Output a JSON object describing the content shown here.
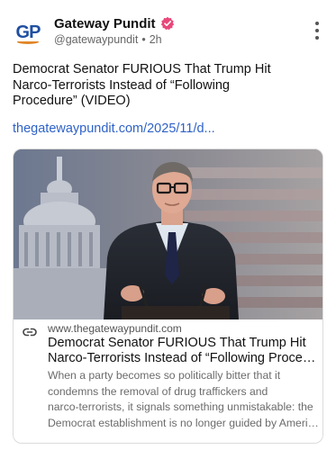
{
  "account": {
    "name": "Gateway Pundit",
    "handle": "@gatewaypundit",
    "separator": "•",
    "time": "2h",
    "avatar_text": "GP",
    "verified_icon": "verified-badge-icon",
    "brand_colors": {
      "blue": "#1f4fa0",
      "orange": "#e0872a",
      "verified": "#e8487a"
    }
  },
  "menu_icon": "more-vertical-icon",
  "post": {
    "text_lines": [
      "Democrat Senator FURIOUS That Trump Hit",
      "Narco-Terrorists Instead of “Following",
      "Procedure” (VIDEO)"
    ],
    "link": "thegatewaypundit.com/2025/11/d..."
  },
  "link_card": {
    "image_alt": "senator-speaking-at-podium-photo",
    "domain": "www.thegatewaypundit.com",
    "domain_icon": "link-icon",
    "title_lines": [
      "Democrat Senator FURIOUS That Trump Hit",
      "Narco-Terrorists Instead of “Following Procedure” (VIDEO)"
    ],
    "description_lines": [
      "When a party becomes so politically bitter that it",
      "condemns the removal of drug traffickers and",
      "narco-terrorists, it signals something unmistakable: the",
      "Democrat establishment is no longer guided by American interests"
    ],
    "link_color": "#2e62c8"
  }
}
